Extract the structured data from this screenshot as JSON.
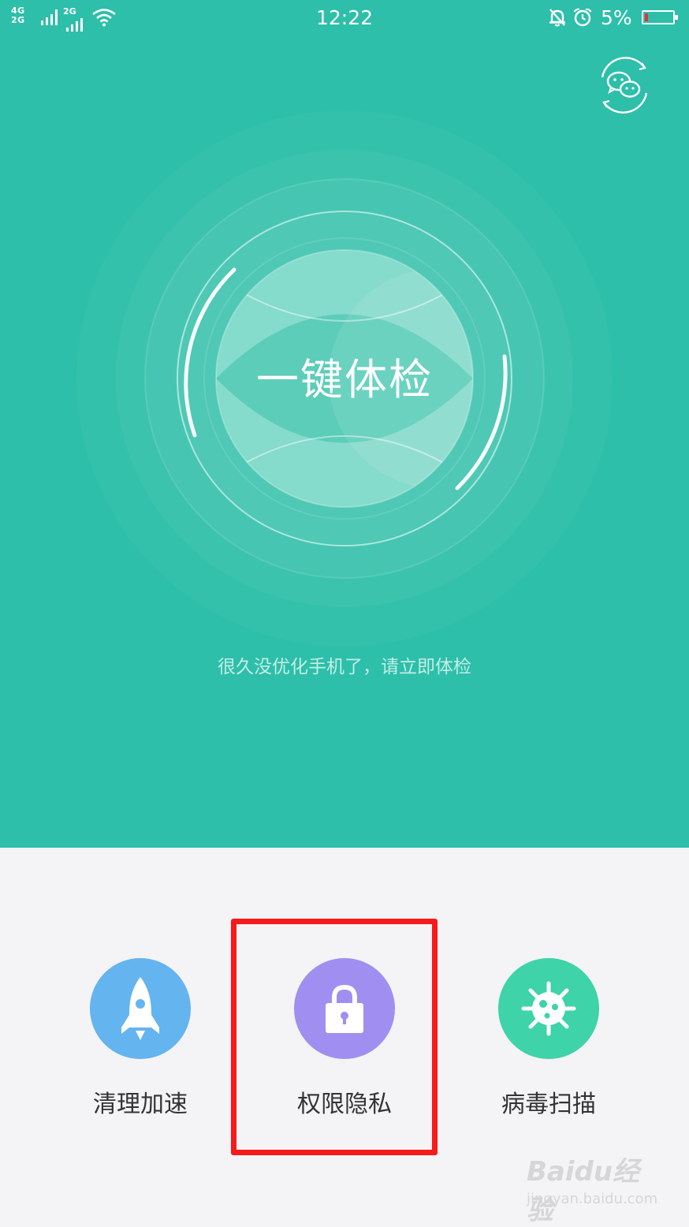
{
  "status_bar": {
    "network_primary": "4G",
    "network_primary_alt": "2G",
    "network_secondary": "2G",
    "time": "12:22",
    "battery_percent": "5%",
    "battery_level": 0.05
  },
  "main": {
    "check_button_label": "一键体检",
    "hint_text": "很久没优化手机了，请立即体检"
  },
  "tools": [
    {
      "label": "清理加速",
      "icon": "rocket-icon",
      "color": "#64b4ef"
    },
    {
      "label": "权限隐私",
      "icon": "lock-icon",
      "color": "#a08ff0"
    },
    {
      "label": "病毒扫描",
      "icon": "virus-icon",
      "color": "#3ed3a8"
    }
  ],
  "colors": {
    "header_bg": "#2dbfa9",
    "page_bg": "#f4f3f6",
    "highlight": "#f71a1a",
    "battery_low": "#e8332f"
  },
  "watermark": {
    "brand": "Baidu经验",
    "url": "jingyan.baidu.com"
  }
}
